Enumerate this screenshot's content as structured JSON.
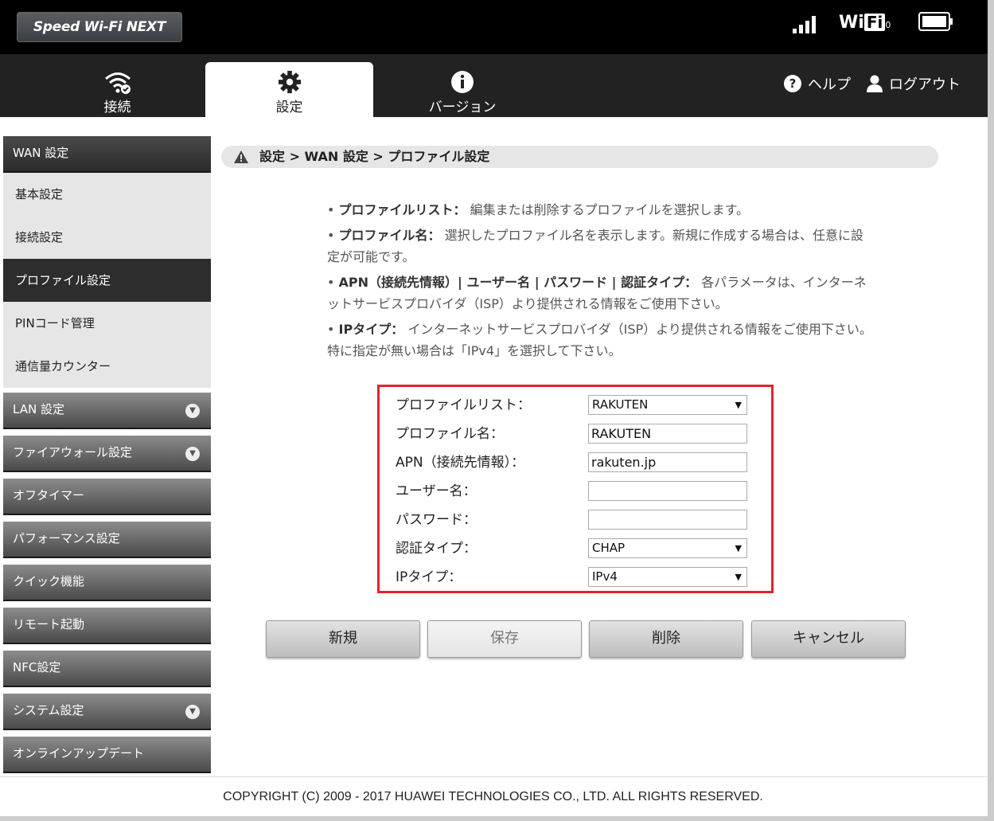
{
  "header": {
    "logo_text": "Speed Wi-Fi NEXT",
    "wifi_prefix": "Wi",
    "wifi_box": "Fi",
    "wifi_sub": "0"
  },
  "nav": {
    "tabs": [
      {
        "label": "接続",
        "icon": "wifi-icon"
      },
      {
        "label": "設定",
        "icon": "gear-icon"
      },
      {
        "label": "バージョン",
        "icon": "info-icon"
      }
    ],
    "help_label": "ヘルプ",
    "logout_label": "ログアウト"
  },
  "sidebar": {
    "wan_header": "WAN 設定",
    "wan_items": [
      "基本設定",
      "接続設定",
      "プロファイル設定",
      "PINコード管理",
      "通信量カウンター"
    ],
    "groups": [
      "LAN 設定",
      "ファイアウォール設定",
      "オフタイマー",
      "パフォーマンス設定",
      "クイック機能",
      "リモート起動",
      "NFC設定",
      "システム設定",
      "オンラインアップデート"
    ]
  },
  "breadcrumb": "設定 > WAN 設定 > プロファイル設定",
  "help": [
    {
      "term": "プロファイルリスト：",
      "desc": "編集または削除するプロファイルを選択します。"
    },
    {
      "term": "プロファイル名：",
      "desc": "選択したプロファイル名を表示します。新規に作成する場合は、任意に設定が可能です。"
    },
    {
      "term": "APN（接続先情報）| ユーザー名 | パスワード | 認証タイプ：",
      "desc": "各パラメータは、インターネットサービスプロバイダ（ISP）より提供される情報をご使用下さい。"
    },
    {
      "term": "IPタイプ：",
      "desc": "インターネットサービスプロバイダ（ISP）より提供される情報をご使用下さい。 特に指定が無い場合は「IPv4」を選択して下さい。"
    }
  ],
  "form": {
    "profile_list_label": "プロファイルリスト：",
    "profile_list_value": "RAKUTEN",
    "profile_name_label": "プロファイル名：",
    "profile_name_value": "RAKUTEN",
    "apn_label": "APN（接続先情報）：",
    "apn_value": "rakuten.jp",
    "username_label": "ユーザー名：",
    "username_value": "",
    "password_label": "パスワード：",
    "password_value": "",
    "auth_label": "認証タイプ：",
    "auth_value": "CHAP",
    "ip_label": "IPタイプ：",
    "ip_value": "IPv4"
  },
  "buttons": {
    "new": "新規",
    "save": "保存",
    "delete": "削除",
    "cancel": "キャンセル"
  },
  "footer": "COPYRIGHT (C) 2009 - 2017 HUAWEI TECHNOLOGIES CO., LTD. ALL RIGHTS RESERVED.",
  "colors": {
    "form_highlight": "#e0242e",
    "header_bg": "#000000",
    "nav_bg": "#222222"
  }
}
